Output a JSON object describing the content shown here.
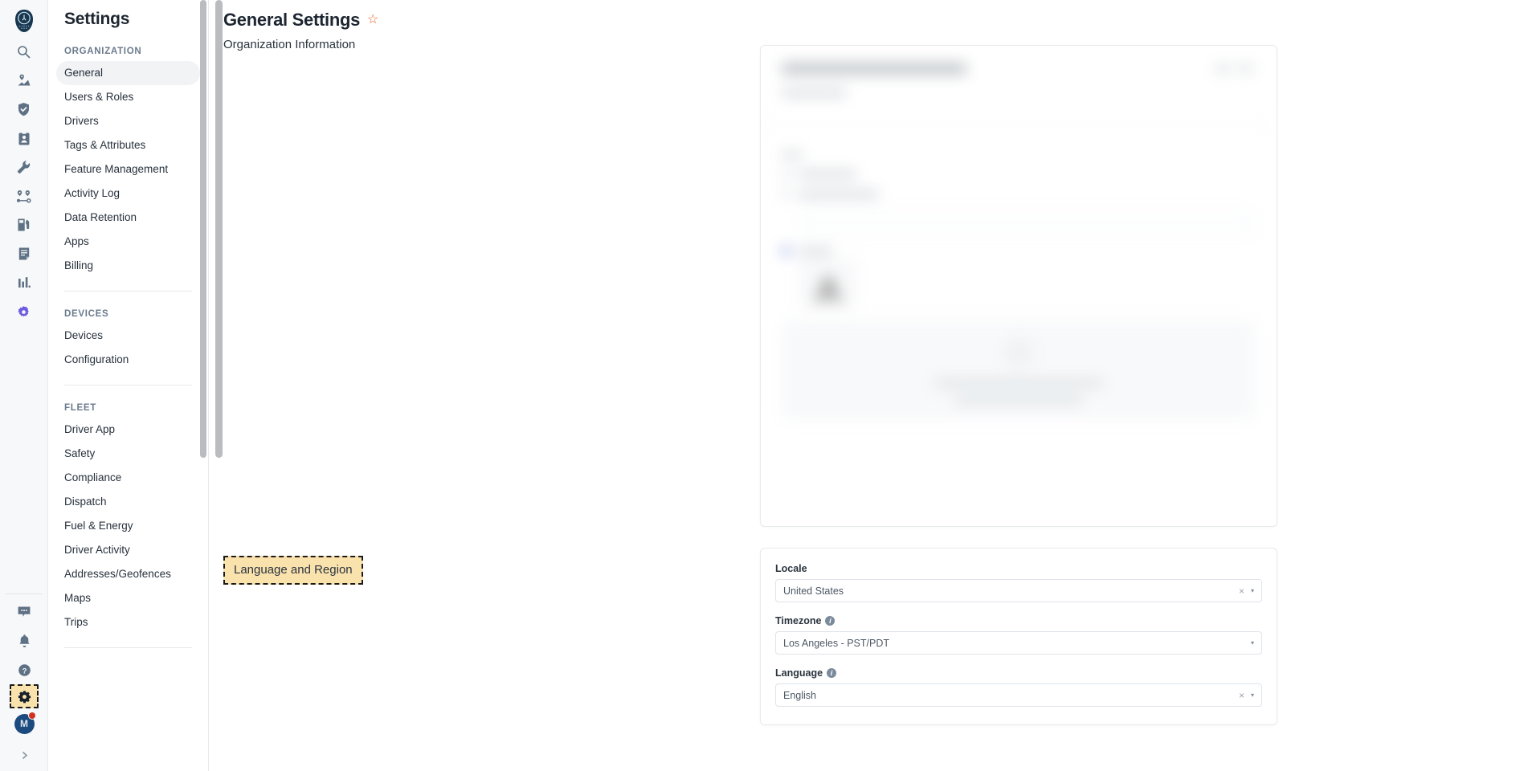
{
  "rail": {
    "logo_name": "owl-brand-logo",
    "top_icons": [
      {
        "name": "search-icon",
        "label": "Search"
      },
      {
        "name": "map-pin-icon",
        "label": "Live Map"
      },
      {
        "name": "shield-icon",
        "label": "Safety"
      },
      {
        "name": "id-badge-icon",
        "label": "Compliance"
      },
      {
        "name": "wrench-icon",
        "label": "Maintenance"
      },
      {
        "name": "route-nodes-icon",
        "label": "Dispatch"
      },
      {
        "name": "fuel-pump-icon",
        "label": "Fuel & Energy"
      },
      {
        "name": "document-icon",
        "label": "Documents"
      },
      {
        "name": "bar-chart-icon",
        "label": "Reports"
      },
      {
        "name": "purple-gear-icon",
        "label": "Beta Features"
      }
    ],
    "bottom_icons": [
      {
        "name": "chat-bubble-icon",
        "label": "Messages"
      },
      {
        "name": "bell-icon",
        "label": "Notifications"
      },
      {
        "name": "help-circle-icon",
        "label": "Help"
      },
      {
        "name": "gear-icon",
        "label": "Settings"
      }
    ],
    "avatar": {
      "initial": "M",
      "has_notification_dot": true
    },
    "expand": {
      "name": "chevron-right-icon",
      "glyph": "›"
    }
  },
  "nav": {
    "title": "Settings",
    "groups": [
      {
        "label": "ORGANIZATION",
        "items": [
          {
            "label": "General",
            "active": true
          },
          {
            "label": "Users & Roles",
            "active": false
          },
          {
            "label": "Drivers",
            "active": false
          },
          {
            "label": "Tags & Attributes",
            "active": false
          },
          {
            "label": "Feature Management",
            "active": false
          },
          {
            "label": "Activity Log",
            "active": false
          },
          {
            "label": "Data Retention",
            "active": false
          },
          {
            "label": "Apps",
            "active": false
          },
          {
            "label": "Billing",
            "active": false
          }
        ]
      },
      {
        "label": "DEVICES",
        "items": [
          {
            "label": "Devices",
            "active": false
          },
          {
            "label": "Configuration",
            "active": false
          }
        ]
      },
      {
        "label": "FLEET",
        "items": [
          {
            "label": "Driver App",
            "active": false
          },
          {
            "label": "Safety",
            "active": false
          },
          {
            "label": "Compliance",
            "active": false
          },
          {
            "label": "Dispatch",
            "active": false
          },
          {
            "label": "Fuel & Energy",
            "active": false
          },
          {
            "label": "Driver Activity",
            "active": false
          },
          {
            "label": "Addresses/Geofences",
            "active": false
          },
          {
            "label": "Maps",
            "active": false
          },
          {
            "label": "Trips",
            "active": false
          }
        ]
      }
    ]
  },
  "page": {
    "title": "General Settings",
    "favorite_star": "☆",
    "star_color": "#e8622b"
  },
  "sections": {
    "org_info": {
      "label": "Organization Information",
      "content_state": "blurred-redacted",
      "logo_letter": "A"
    },
    "language_region": {
      "label": "Language and Region",
      "highlighted": true,
      "highlight_bg": "#fae2ad",
      "highlight_border": "#1a1a1a",
      "fields": [
        {
          "label": "Locale",
          "value": "United States",
          "has_info": false,
          "clearable": true,
          "clear_glyph": "×",
          "caret_glyph": "▾"
        },
        {
          "label": "Timezone",
          "value": "Los Angeles - PST/PDT",
          "has_info": true,
          "clearable": false,
          "clear_glyph": "×",
          "caret_glyph": "▾"
        },
        {
          "label": "Language",
          "value": "English",
          "has_info": true,
          "clearable": true,
          "clear_glyph": "×",
          "caret_glyph": "▾"
        }
      ],
      "info_glyph": "i"
    }
  },
  "colors": {
    "accent_orange": "#e8622b",
    "highlight_tan": "#fae2ad",
    "avatar_blue": "#1b4b7e",
    "notify_red": "#d0321e",
    "rail_bg": "#f7f8f9",
    "active_pill": "#f2f3f5"
  }
}
